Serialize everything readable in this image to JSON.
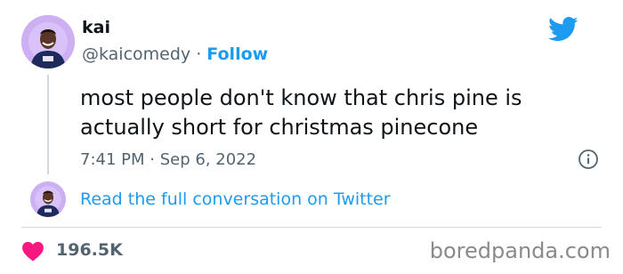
{
  "author": {
    "name": "kai",
    "handle": "@kaicomedy",
    "separator": " · ",
    "follow_label": "Follow"
  },
  "tweet": {
    "text": "most people don't know that chris pine is actually short for christmas pinecone",
    "time": "7:41 PM",
    "separator": " · ",
    "date": "Sep 6, 2022"
  },
  "conversation_link": "Read the full conversation on Twitter",
  "likes": {
    "count": "196.5K"
  },
  "watermark": "boredpanda.com",
  "icons": {
    "brand": "twitter-bird-icon",
    "info": "info-icon",
    "like": "heart-icon"
  },
  "colors": {
    "accent": "#1d9bf0",
    "heart": "#f91880",
    "text": "#0f1419",
    "muted": "#536471",
    "avatar_bg": "#c9a9f3"
  }
}
